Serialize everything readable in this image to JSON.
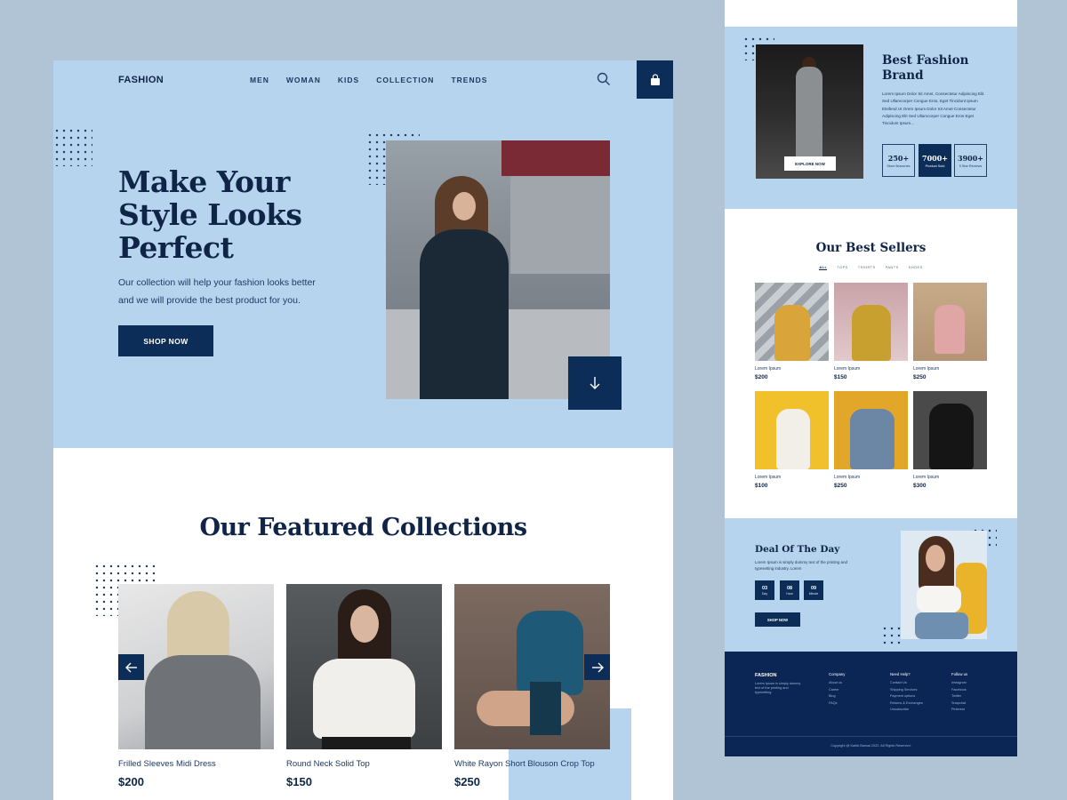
{
  "main": {
    "logo": "FASHION",
    "nav": [
      "MEN",
      "WOMAN",
      "KIDS",
      "COLLECTION",
      "TRENDS"
    ],
    "hero": {
      "title": "Make Your Style Looks Perfect",
      "subtitle": "Our collection will help your fashion looks better and we will provide the best product for you.",
      "cta": "SHOP NOW"
    },
    "featured": {
      "title": "Our Featured Collections",
      "products": [
        {
          "name": "Frilled Sleeves Midi Dress",
          "price": "$200"
        },
        {
          "name": "Round Neck Solid Top",
          "price": "$150"
        },
        {
          "name": "White Rayon Short Blouson Crop Top",
          "price": "$250"
        }
      ]
    }
  },
  "brand": {
    "title": "Best Fashion Brand",
    "description": "Lorem Ipsum Dolor Sit Amet, Consectetur Adipiscing Elit. Sed Ullamcorper Congue Eros, Eget Tincidunt Ipsum Eleifend Ut Orem Ipsum Dolor Sit Amet Consectetur Adipiscing Elit Sed Ullamcorper Congue Eros Eget Tincidunt Ipsum...",
    "explore": "EXPLORE NOW",
    "stats": [
      {
        "num": "250+",
        "label": "Store Branches"
      },
      {
        "num": "7000+",
        "label": "Product Sold"
      },
      {
        "num": "3900+",
        "label": "5 Star Reviews"
      }
    ]
  },
  "sellers": {
    "title": "Our Best Sellers",
    "tabs": [
      "ALL",
      "TOPS",
      "TSHIRTS",
      "PANTS",
      "SHOES"
    ],
    "items": [
      {
        "name": "Lorem Ipsum",
        "price": "$200"
      },
      {
        "name": "Lorem Ipsum",
        "price": "$150"
      },
      {
        "name": "Lorem Ipsum",
        "price": "$250"
      },
      {
        "name": "Lorem Ipsum",
        "price": "$100"
      },
      {
        "name": "Lorem Ipsum",
        "price": "$250"
      },
      {
        "name": "Lorem Ipsum",
        "price": "$300"
      }
    ]
  },
  "deal": {
    "title": "Deal Of The Day",
    "description": "Lorem Ipsum is simply dummy text of the printing and typesetting industry. Lorem",
    "countdown": [
      {
        "value": "03",
        "unit": "Day"
      },
      {
        "value": "08",
        "unit": "Hour"
      },
      {
        "value": "09",
        "unit": "Minute"
      }
    ],
    "cta": "SHOP NOW"
  },
  "footer": {
    "logo": "FASHION",
    "about": "Lorem Ipsum is simply dummy text of the printing and typesetting",
    "columns": [
      {
        "heading": "Company",
        "items": [
          "About us",
          "Career",
          "Blog",
          "FAQs"
        ]
      },
      {
        "heading": "Need Help?",
        "items": [
          "Contact Us",
          "Shipping Services",
          "Payment options",
          "Returns & Exchanges",
          "Unsubscribe"
        ]
      },
      {
        "heading": "Follow us",
        "items": [
          "Instagram",
          "Facebook",
          "Twitter",
          "Snapchat",
          "Pinterest"
        ]
      }
    ],
    "copyright": "Copyright @ Kartik Bansal 2022. All Rights Reserved."
  },
  "colors": {
    "primary": "#0b2d57",
    "hero_bg": "#b7d4ef",
    "page_bg": "#b1c4d6",
    "footer_bg": "#0b2555"
  }
}
